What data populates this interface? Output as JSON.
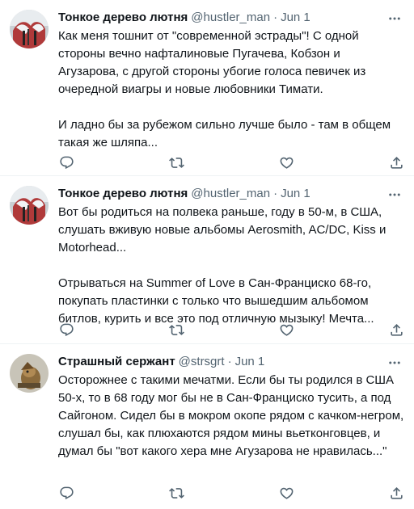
{
  "tweets": [
    {
      "name": "Тонкое дерево лютня",
      "handle": "@hustler_man",
      "date": "Jun 1",
      "paragraphs": [
        "Как меня тошнит от \"современной эстрады\"! С одной стороны вечно нафталиновые Пугачева, Кобзон и Агузарова, с другой стороны убогие голоса певичек из очередной виагры и новые любовники Тимати.",
        "И ладно бы за рубежом сильно лучше было - там в общем такая же шляпа..."
      ]
    },
    {
      "name": "Тонкое дерево лютня",
      "handle": "@hustler_man",
      "date": "Jun 1",
      "paragraphs": [
        "Вот бы родиться на полвека раньше, году в 50-м, в США, слушать вживую новые альбомы Aerosmith, AC/DC, Kiss и Motorhead...",
        "Отрываться на Summer of Love в Сан-Франциско 68-го, покупать пластинки с только что вышедшим альбомом битлов, курить и все это под отличную мызыку! Мечта..."
      ]
    },
    {
      "name": "Страшный сержант",
      "handle": "@strsgrt",
      "date": "Jun 1",
      "paragraphs": [
        "Осторожнее с такими мечатми. Если бы ты родился в США 50-х, то в 68 году мог бы не в Сан-Франциско тусить, а под Сайгоном. Сидел бы в мокром окопе рядом с качком-негром, слушал бы, как плюхаются рядом мины вьетконговцев, и думал бы \"вот какого хера мне Агузарова не нравилась...\""
      ]
    }
  ],
  "separator": "·",
  "icons": {
    "more": "more-dots-icon",
    "reply": "reply-icon",
    "retweet": "retweet-icon",
    "like": "like-icon",
    "share": "share-icon"
  }
}
